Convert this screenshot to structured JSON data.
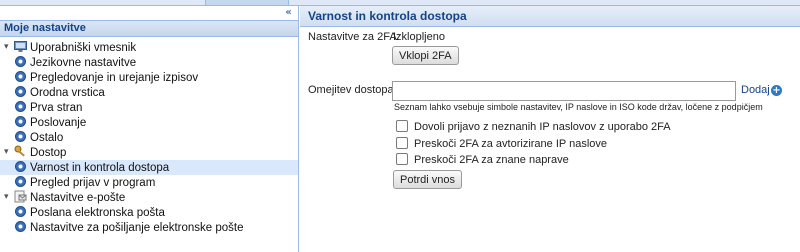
{
  "sidebar": {
    "header": "Moje nastavitve",
    "collapse_icon": "«",
    "groups": [
      {
        "label": "Uporabniški vmesnik",
        "icon": "monitor-icon",
        "items": [
          {
            "label": "Jezikovne nastavitve",
            "icon": "gear-icon"
          },
          {
            "label": "Pregledovanje in urejanje izpisov",
            "icon": "gear-icon"
          },
          {
            "label": "Orodna vrstica",
            "icon": "gear-icon"
          },
          {
            "label": "Prva stran",
            "icon": "gear-icon"
          },
          {
            "label": "Poslovanje",
            "icon": "gear-icon"
          },
          {
            "label": "Ostalo",
            "icon": "gear-icon"
          }
        ]
      },
      {
        "label": "Dostop",
        "icon": "key-icon",
        "items": [
          {
            "label": "Varnost in kontrola dostopa",
            "icon": "gear-icon",
            "selected": true
          },
          {
            "label": "Pregled prijav v program",
            "icon": "gear-icon"
          }
        ]
      },
      {
        "label": "Nastavitve e-pošte",
        "icon": "mail-icon",
        "items": [
          {
            "label": "Poslana elektronska pošta",
            "icon": "gear-icon"
          },
          {
            "label": "Nastavitve za pošiljanje elektronske pošte",
            "icon": "gear-icon"
          }
        ]
      }
    ]
  },
  "main": {
    "title": "Varnost in kontrola dostopa",
    "twofa_label": "Nastavitve za 2FA:",
    "twofa_status": "Izklopljeno",
    "twofa_button": "Vklopi 2FA",
    "restriction_label": "Omejitev dostopa:",
    "restriction_value": "",
    "add_label": "Dodaj",
    "add_icon": "plus-circle-icon",
    "hint": "Seznam lahko vsebuje simbole nastavitev, IP naslove in ISO kode držav, ločene z podpičjem",
    "checkboxes": [
      {
        "label": "Dovoli prijavo z neznanih IP naslovov z uporabo 2FA",
        "checked": false
      },
      {
        "label": "Preskoči 2FA za avtorizirane IP naslove",
        "checked": false
      },
      {
        "label": "Preskoči 2FA za znane naprave",
        "checked": false
      }
    ],
    "confirm_button": "Potrdi vnos"
  },
  "colors": {
    "accent": "#15428b",
    "border": "#99bbe8",
    "selected_row": "#d9e8fb",
    "add_icon": "#2b78c8"
  }
}
